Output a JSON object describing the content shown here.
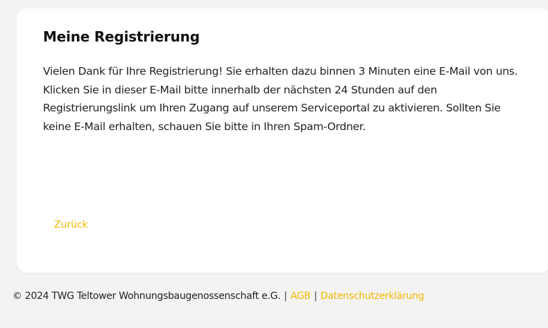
{
  "card": {
    "title": "Meine Registrierung",
    "text": "Vielen Dank für Ihre Registrierung! Sie erhalten dazu binnen 3 Minuten eine E-Mail von uns. Klicken Sie in dieser E-Mail bitte innerhalb der nächsten 24 Stunden auf den Registrierungslink um Ihren Zugang auf unserem Serviceportal zu aktivieren. Sollten Sie keine E-Mail erhalten, schauen Sie bitte in Ihren Spam-Ordner.",
    "back_label": "Zurück"
  },
  "footer": {
    "copyright": "© 2024 TWG Teltower Wohnungsbaugenossenschaft e.G.",
    "separator": "|",
    "agb_label": "AGB",
    "privacy_label": "Datenschutzerklärung"
  },
  "colors": {
    "accent": "#f5b800",
    "background": "#f3f3f3",
    "card": "#ffffff"
  }
}
